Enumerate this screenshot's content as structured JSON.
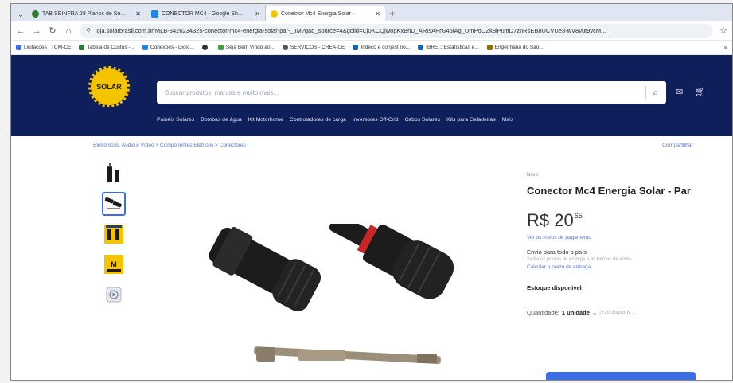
{
  "browser": {
    "tabs": [
      {
        "title": "TAB SEINFRA 28 Planos de Se...",
        "favicon_color": "#2e7d32",
        "active": false
      },
      {
        "title": "CONECTOR MC4 - Google Sh...",
        "favicon_color": "#1e88e5",
        "active": false
      },
      {
        "title": "Conector Mc4 Energia Solar -",
        "favicon_color": "#f5c400",
        "active": true
      }
    ],
    "new_tab_label": "+",
    "url": "loja.solarbrasil.com.br/MLB-3426234325-conector-mc4-energia-solar-par-_JM?gad_source=4&gclid=Cj0KCQjw8pKxBhD_ARIsAPrG45lAg_UmPoOZk8lPujttD7znRsEB8UCVUe3-wV8vut9ycM...",
    "bookmarks": [
      {
        "label": "Licitações | TCM-CE",
        "color": "#3b6ee6"
      },
      {
        "label": "Tabela de Custos -...",
        "color": "#2e7d32"
      },
      {
        "label": "Conexões - Dicio...",
        "color": "#1e88e5"
      },
      {
        "label": "",
        "color": "#333333"
      },
      {
        "label": "Seja Bem Vindo ao...",
        "color": "#43a047"
      },
      {
        "label": "SERVICOS - CREA-CE",
        "color": "#555555"
      },
      {
        "label": "Indeco e conjest no...",
        "color": "#1565c0"
      },
      {
        "label": "IBRE :: Estatísticas e...",
        "color": "#1565c0"
      },
      {
        "label": "Engenharia do Sao...",
        "color": "#8d6e00"
      }
    ],
    "bookmarks_more": "»"
  },
  "site": {
    "logo_text": "SOLAR",
    "search_placeholder": "Buscar produtos, marcas e muito mais...",
    "categories": [
      "Painéis Solares",
      "Bombas de água",
      "Kit Motorhome",
      "Controladores de carga",
      "Inversores Off-Grid",
      "Cabos Solares",
      "Kits para Geladeiras",
      "Mais"
    ],
    "breadcrumb": "Eletrônicos, Áudio e Vídeo  >  Componentes Elétricos  >  Conectores",
    "share": "Compartilhar"
  },
  "product": {
    "brand": "Novo",
    "title": "Conector Mc4 Energia Solar - Par",
    "price_main": "R$ 20",
    "price_cents": "65",
    "payment_link": "Ver os meios de pagamento",
    "shipping_title": "Envio para todo o país",
    "shipping_sub": "Saiba os prazos de entrega e as formas de envio.",
    "shipping_link": "Calcular o prazo de entrega",
    "stock": "Estoque disponível",
    "qty_label": "Quantidade:",
    "qty_value": "1 unidade",
    "qty_avail": "(+20 disponív..."
  },
  "colors": {
    "header_bg": "#0e1f5c",
    "accent": "#3b6ee6",
    "logo_yellow": "#f5c400"
  }
}
